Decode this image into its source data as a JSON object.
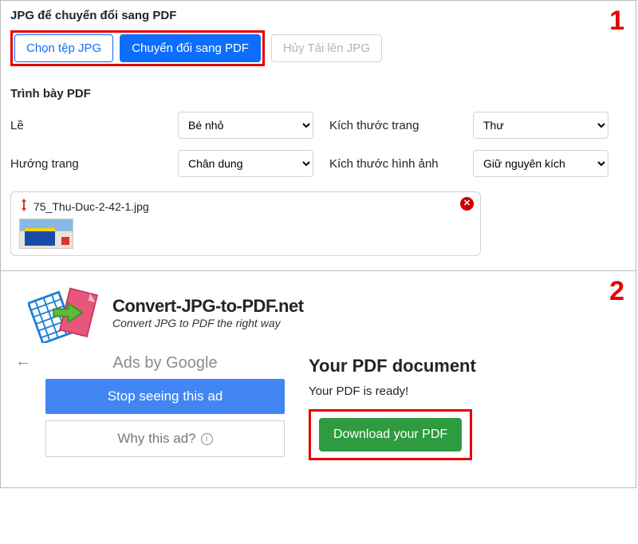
{
  "steps": {
    "one": "1",
    "two": "2"
  },
  "top": {
    "heading": "JPG để chuyển đổi sang PDF",
    "choose_btn": "Chọn tệp JPG",
    "convert_btn": "Chuyển đổi sang PDF",
    "cancel_btn": "Hủy Tải lên JPG"
  },
  "layout": {
    "heading": "Trình bày PDF",
    "margin_label": "Lề",
    "margin_value": "Bé nhỏ",
    "page_size_label": "Kích thước trang",
    "page_size_value": "Thư",
    "orientation_label": "Hướng trang",
    "orientation_value": "Chân dung",
    "image_size_label": "Kích thước hình ảnh",
    "image_size_value": "Giữ nguyên kích"
  },
  "file": {
    "name": "75_Thu-Duc-2-42-1.jpg"
  },
  "brand": {
    "title": "Convert-JPG-to-PDF.net",
    "sub": "Convert JPG to PDF the right way"
  },
  "ads": {
    "head_prefix": "Ads by ",
    "head_google": "Google",
    "stop": "Stop seeing this ad",
    "why": "Why this ad?"
  },
  "result": {
    "title": "Your PDF document",
    "ready": "Your PDF is ready!",
    "download": "Download your PDF"
  }
}
